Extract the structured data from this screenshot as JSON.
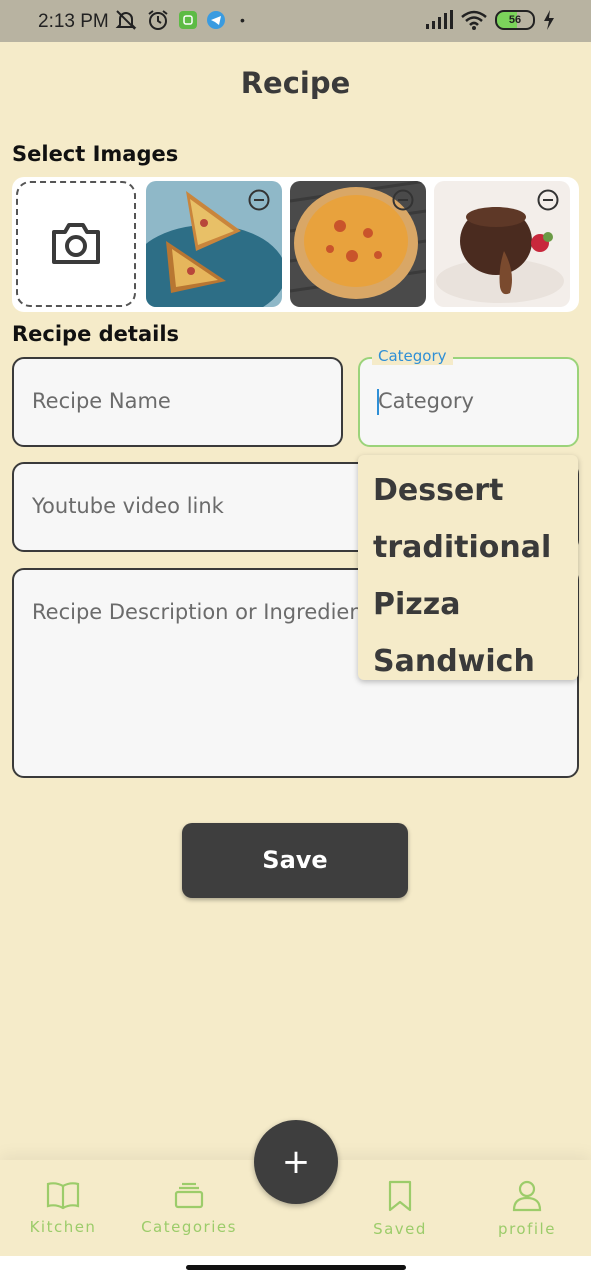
{
  "status_bar": {
    "time": "2:13 PM",
    "battery": "56",
    "left_icons": [
      "bell-off-icon",
      "alarm-icon",
      "app-icon",
      "telegram-icon",
      "dot-icon"
    ],
    "right_icons": [
      "signal-icon",
      "wifi-icon",
      "battery-icon",
      "charging-icon"
    ]
  },
  "header": {
    "title": "Recipe"
  },
  "images_section": {
    "label": "Select Images",
    "images": [
      {
        "name": "sandwich-image"
      },
      {
        "name": "pizza-image"
      },
      {
        "name": "lava-cake-image"
      }
    ]
  },
  "details_section": {
    "label": "Recipe details"
  },
  "fields": {
    "recipe_name_placeholder": "Recipe Name",
    "category_label": "Category",
    "category_placeholder": "Category",
    "youtube_placeholder": "Youtube video link",
    "description_placeholder": "Recipe Description or Ingredients"
  },
  "dropdown": {
    "options": [
      "Dessert",
      "traditional",
      "Pizza",
      "Sandwich"
    ]
  },
  "save_button": {
    "label": "Save"
  },
  "bottom_nav": {
    "items": [
      {
        "label": "Kitchen",
        "icon": "book-icon"
      },
      {
        "label": "Categories",
        "icon": "stack-icon"
      },
      {
        "label": "Saved",
        "icon": "bookmark-icon"
      },
      {
        "label": "profile",
        "icon": "person-icon"
      }
    ],
    "fab_label": "+"
  },
  "colors": {
    "background": "#f5ebc9",
    "accent_blue": "#2f8fd6",
    "nav_green": "#9ccc6a",
    "button_dark": "#3e3e3e"
  }
}
